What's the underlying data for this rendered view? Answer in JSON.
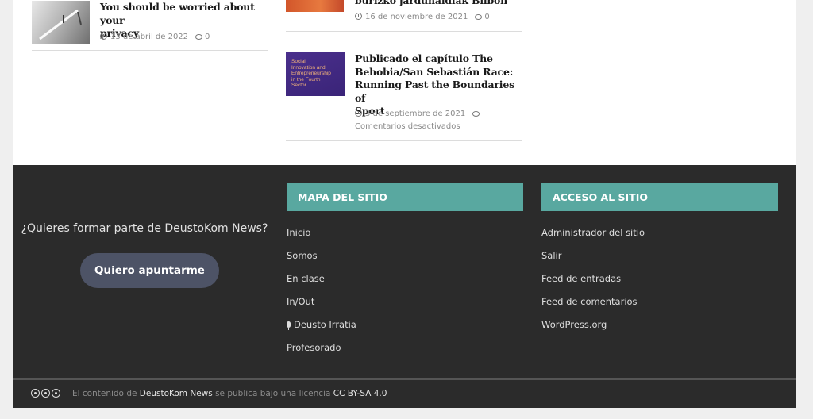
{
  "posts": {
    "left": {
      "title_line1": "You should be worried about your",
      "title_line2": "privacy",
      "date": "13 de abril de 2022",
      "comments": "0"
    },
    "right_top": {
      "title_line": "burizko jardunaldiak Bilbon",
      "date": "16 de noviembre de 2021",
      "comments": "0"
    },
    "right_bottom": {
      "thumb_lines": [
        "Social",
        "Innovation and",
        "Entrepreneurship",
        "in the Fourth",
        "Sector"
      ],
      "title_line1": "Publicado el capítulo The",
      "title_line2": "Behobia/San Sebastián Race:",
      "title_line3": "Running Past the Boundaries of",
      "title_line4": "Sport",
      "date": "3 de septiembre de 2021",
      "comments": "Comentarios desactivados"
    }
  },
  "footer": {
    "cta_text": "¿Quieres formar parte de DeustoKom News?",
    "cta_button": "Quiero apuntarme",
    "sitemap": {
      "title": "MAPA DEL SITIO",
      "items": [
        "Inicio",
        "Somos",
        "En clase",
        "In/Out",
        "Deusto Irratia",
        "Profesorado"
      ]
    },
    "access": {
      "title": "ACCESO AL SITIO",
      "items": [
        "Administrador del sitio",
        "Salir",
        "Feed de entradas",
        "Feed de comentarios",
        "WordPress.org"
      ]
    },
    "license": {
      "prefix": "El contenido de",
      "site": "DeustoKom News",
      "middle": "se publica bajo una licencia",
      "license_name": "CC BY-SA 4.0"
    }
  },
  "colors": {
    "accent_teal": "#59a8a0",
    "footer_bg": "#2b2b2b",
    "button_bg": "#4d5366"
  }
}
